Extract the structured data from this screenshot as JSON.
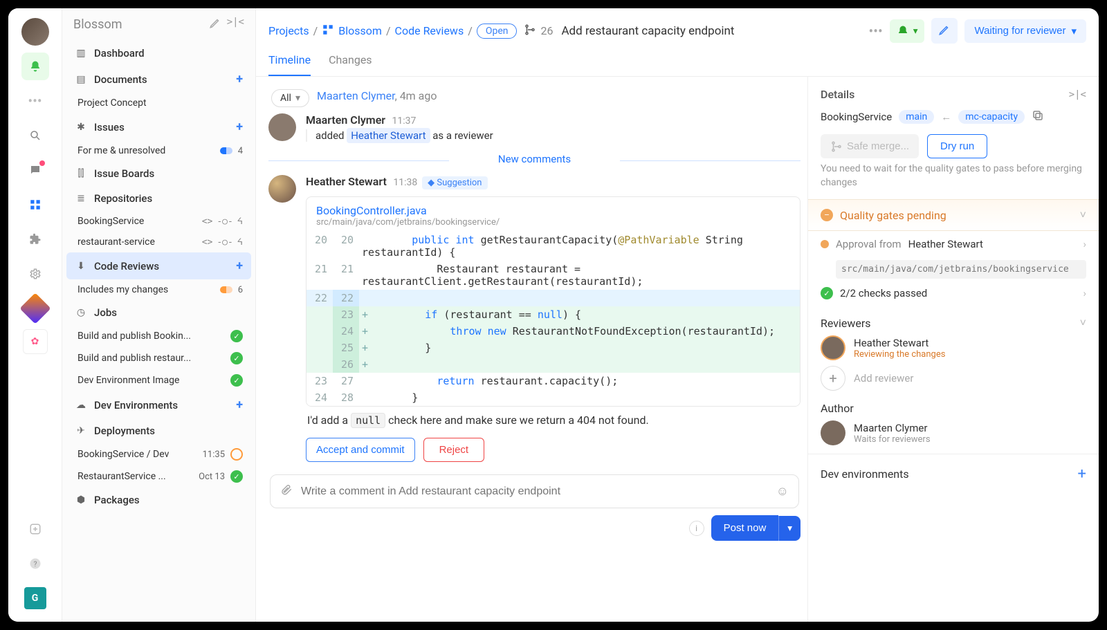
{
  "workspace": "Blossom",
  "sidebar": {
    "items": [
      {
        "icon": "dashboard",
        "label": "Dashboard"
      },
      {
        "icon": "doc",
        "label": "Documents",
        "add": true,
        "children": [
          {
            "label": "Project Concept"
          }
        ]
      },
      {
        "icon": "asterisk",
        "label": "Issues",
        "add": true,
        "children": [
          {
            "label": "For me & unresolved",
            "badge": "4",
            "dots": "blue"
          }
        ]
      },
      {
        "icon": "board",
        "label": "Issue Boards"
      },
      {
        "icon": "repo",
        "label": "Repositories",
        "children": [
          {
            "label": "BookingService",
            "tags": "repo"
          },
          {
            "label": "restaurant-service",
            "tags": "repo"
          }
        ]
      },
      {
        "icon": "review",
        "label": "Code Reviews",
        "add": true,
        "selected": true,
        "children": [
          {
            "label": "Includes my changes",
            "badge": "6",
            "dots": "orange"
          }
        ]
      },
      {
        "icon": "job",
        "label": "Jobs",
        "children": [
          {
            "label": "Build and publish Bookin...",
            "status": "ok"
          },
          {
            "label": "Build and publish restaur...",
            "status": "ok"
          },
          {
            "label": "Dev Environment Image",
            "status": "ok"
          }
        ]
      },
      {
        "icon": "cloud",
        "label": "Dev Environments",
        "add": true
      },
      {
        "icon": "deploy",
        "label": "Deployments",
        "children": [
          {
            "label": "BookingService / Dev",
            "meta": "11:35",
            "status": "progress"
          },
          {
            "label": "RestaurantService ...",
            "meta": "Oct 13",
            "status": "ok"
          }
        ]
      },
      {
        "icon": "pkg",
        "label": "Packages"
      }
    ]
  },
  "breadcrumb": {
    "root": "Projects",
    "project": "Blossom",
    "section": "Code Reviews",
    "status": "Open",
    "mr": "26",
    "title": "Add restaurant capacity endpoint"
  },
  "state_button": "Waiting for reviewer",
  "tabs": [
    "Timeline",
    "Changes"
  ],
  "filter_chip": "All",
  "prev_entry": {
    "author": "Maarten Clymer",
    "when": "4m ago"
  },
  "timeline": [
    {
      "kind": "event",
      "author": "Maarten Clymer",
      "time": "11:37",
      "action_prefix": "added",
      "target": "Heather Stewart",
      "action_suffix": "as a reviewer"
    },
    {
      "kind": "divider",
      "label": "New comments"
    },
    {
      "kind": "suggestion",
      "author": "Heather Stewart",
      "time": "11:38",
      "badge": "Suggestion",
      "file": "BookingController.java",
      "path": "src/main/java/com/jetbrains/bookingservice/",
      "diff": [
        {
          "l": "20",
          "r": "20",
          "t": "ctx",
          "code": "        public int getRestaurantCapacity(@PathVariable String restaurantId) {"
        },
        {
          "l": "21",
          "r": "21",
          "t": "ctx",
          "code": "            Restaurant restaurant = restaurantClient.getRestaurant(restaurantId);"
        },
        {
          "l": "22",
          "r": "22",
          "t": "sel",
          "code": ""
        },
        {
          "l": "",
          "r": "23",
          "t": "add",
          "code": "        if (restaurant == null) {"
        },
        {
          "l": "",
          "r": "24",
          "t": "add",
          "code": "            throw new RestaurantNotFoundException(restaurantId);"
        },
        {
          "l": "",
          "r": "25",
          "t": "add",
          "code": "        }"
        },
        {
          "l": "",
          "r": "26",
          "t": "add",
          "code": ""
        },
        {
          "l": "23",
          "r": "27",
          "t": "ctx",
          "code": "            return restaurant.capacity();"
        },
        {
          "l": "24",
          "r": "28",
          "t": "ctx",
          "code": "        }"
        }
      ],
      "message_pre": "I'd add a ",
      "message_code": "null",
      "message_post": " check here and make sure we return a 404 not found.",
      "accept": "Accept and commit",
      "reject": "Reject"
    }
  ],
  "composer": {
    "placeholder": "Write a comment in Add restaurant capacity endpoint",
    "post": "Post now"
  },
  "details": {
    "heading": "Details",
    "repo": "BookingService",
    "target_branch": "main",
    "source_branch": "mc-capacity",
    "safe_merge": "Safe merge...",
    "dry_run": "Dry run",
    "wait_note": "You need to wait for the quality gates to pass before merging changes",
    "pending": "Quality gates pending",
    "approval_prefix": "Approval from ",
    "approval_name": "Heather Stewart",
    "approval_path": "src/main/java/com/jetbrains/bookingservice",
    "checks": "2/2 checks passed",
    "reviewers_h": "Reviewers",
    "reviewer": {
      "name": "Heather Stewart",
      "status": "Reviewing the changes"
    },
    "add_rev": "Add reviewer",
    "author_h": "Author",
    "author": {
      "name": "Maarten Clymer",
      "status": "Waits for reviewers"
    },
    "devenv": "Dev environments"
  }
}
